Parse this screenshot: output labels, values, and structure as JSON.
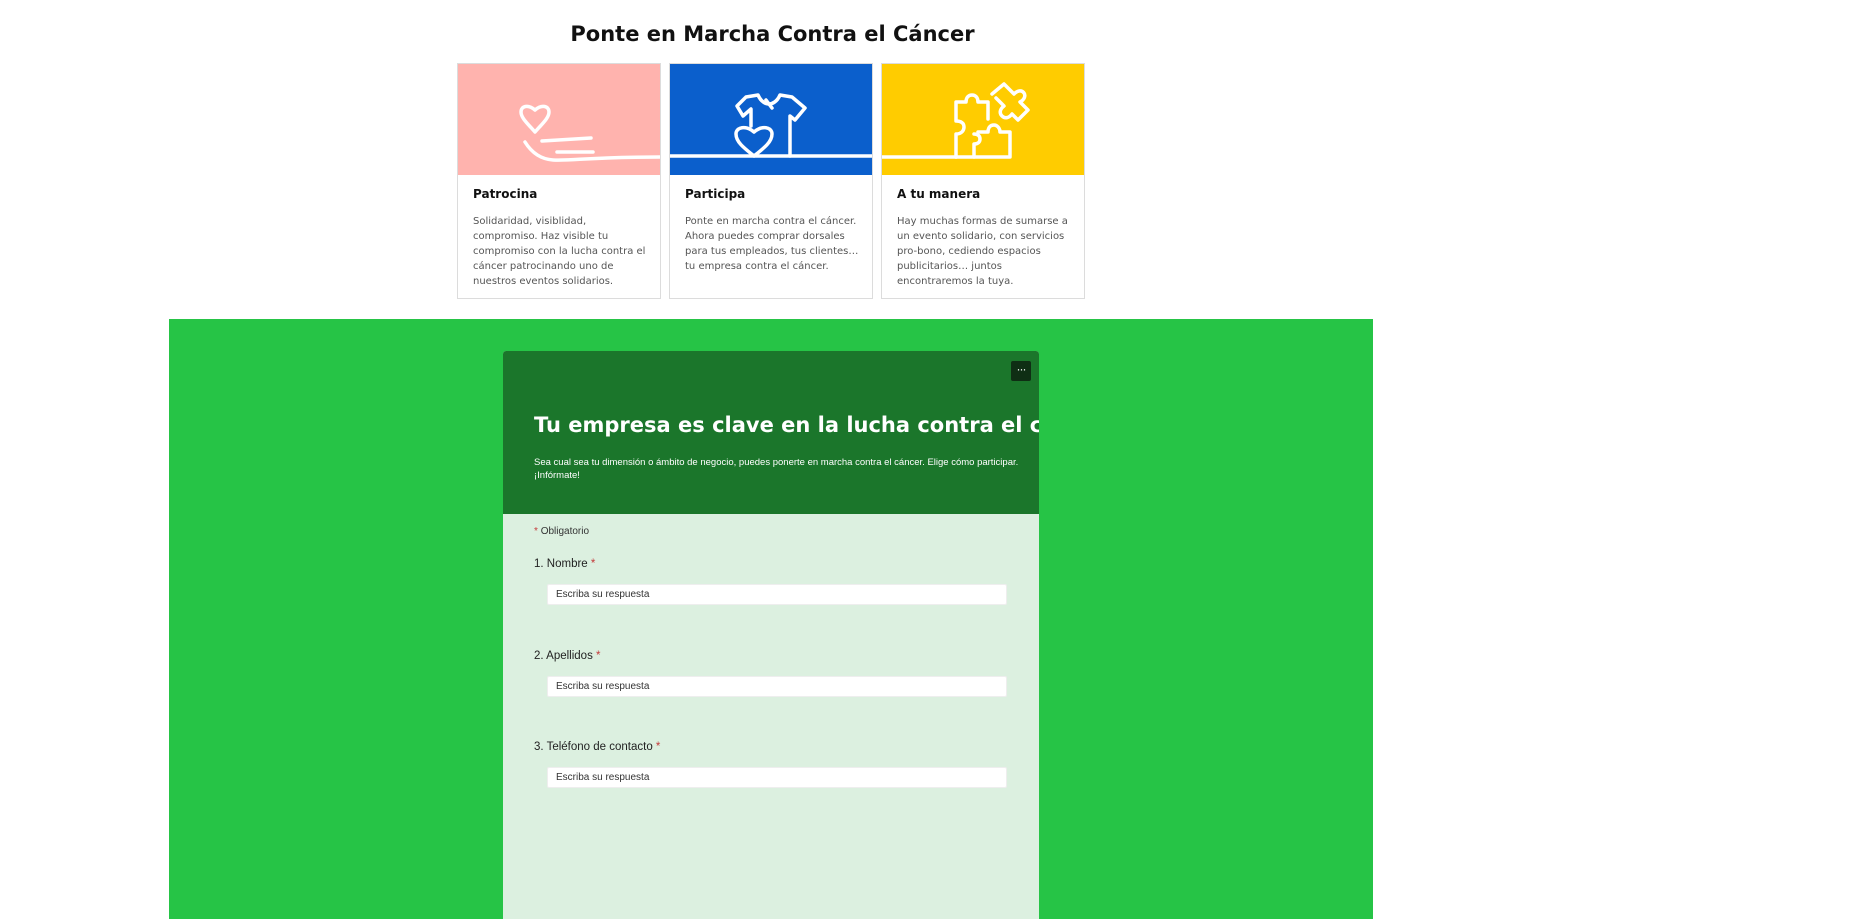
{
  "heading": "Ponte en Marcha Contra el Cáncer",
  "cards": [
    {
      "title": "Patrocina",
      "text": "Solidaridad, visiblidad, compromiso. Haz visible tu compromiso con la lucha contra el cáncer patrocinando uno de nuestros eventos solidarios.",
      "color": "#ffb3ae",
      "icon": "hand-heart-icon"
    },
    {
      "title": "Participa",
      "text": "Ponte en marcha contra el cáncer. Ahora puedes comprar dorsales para tus empleados, tus clientes… tu empresa contra el cáncer.",
      "color": "#0b5fcc",
      "icon": "tshirt-heart-icon"
    },
    {
      "title": "A tu manera",
      "text": "Hay muchas formas de sumarse a un evento solidario, con servicios pro-bono, cediendo espacios publicitarios… juntos encontraremos la tuya.",
      "color": "#ffcc00",
      "icon": "puzzle-icon"
    }
  ],
  "colors": {
    "band": "#26c446",
    "form_header": "#1b762b",
    "form_body": "#dcf0e0"
  },
  "form": {
    "more_button": "···",
    "title": "Tu empresa es clave en la lucha contra el cáncer",
    "description": "Sea cual sea tu dimensión o ámbito de negocio, puedes ponerte en marcha contra el cáncer. Elige cómo participar. ¡Infórmate!",
    "required_mark": "*",
    "required_note": "Obligatorio",
    "questions": [
      {
        "label": "1. Nombre",
        "placeholder": "Escriba su respuesta"
      },
      {
        "label": "2. Apellidos",
        "placeholder": "Escriba su respuesta"
      },
      {
        "label": "3. Teléfono de contacto",
        "placeholder": "Escriba su respuesta"
      }
    ]
  }
}
